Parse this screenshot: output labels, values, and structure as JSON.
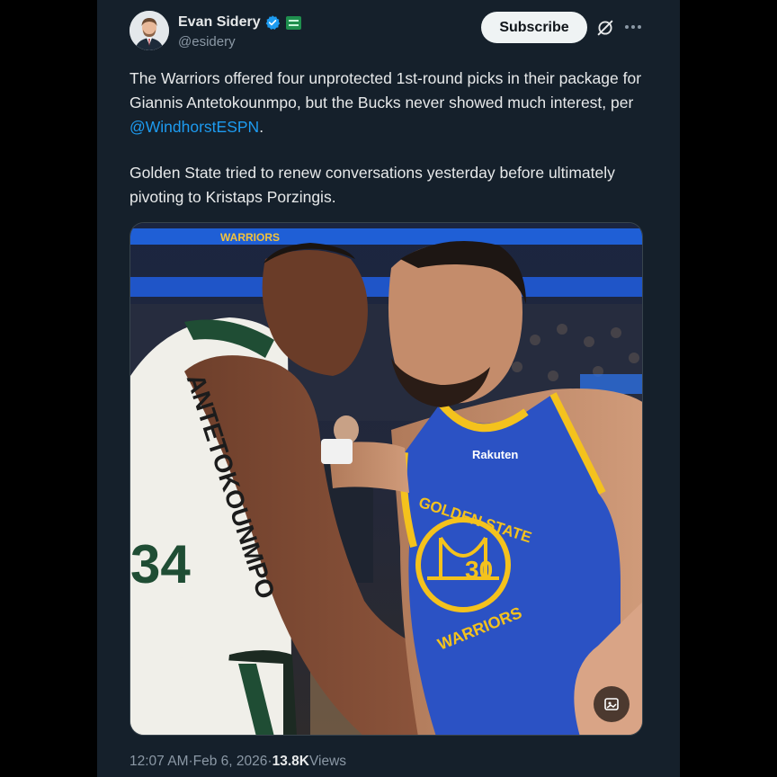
{
  "author": {
    "display_name": "Evan Sidery",
    "handle": "@esidery",
    "verified_color": "#1d9bf0",
    "affiliate_badge_color": "#1f8f4e"
  },
  "actions": {
    "subscribe_label": "Subscribe",
    "grok_icon": "grok-icon",
    "more_icon": "more-icon"
  },
  "tweet": {
    "paragraph1_text": "The Warriors offered four unprotected 1st-round picks in their package for Giannis Antetokounmpo, but the Bucks never showed much interest, per ",
    "paragraph1_mention": "@WindhorstESPN",
    "paragraph1_end": ".",
    "paragraph2": "Golden State tried to renew conversations yesterday before ultimately pivoting to Kristaps Porzingis."
  },
  "media": {
    "arena_banner_text": "WARRIORS",
    "jersey_left_name": "ANTETOKOUNMPO",
    "jersey_left_number": "34",
    "jersey_right_team": "GOLDEN STATE",
    "jersey_right_team_bottom": "WARRIORS",
    "jersey_right_number": "30",
    "jersey_right_sponsor": "Rakuten",
    "alt_icon": "image-alt-icon"
  },
  "footer": {
    "time": "12:07 AM",
    "separator": " · ",
    "date": "Feb 6, 2026",
    "views_count": "13.8K",
    "views_label": " Views"
  },
  "colors": {
    "background": "#15202b",
    "text": "#e7e9ea",
    "muted": "#8b98a5",
    "link": "#1d9bf0"
  }
}
